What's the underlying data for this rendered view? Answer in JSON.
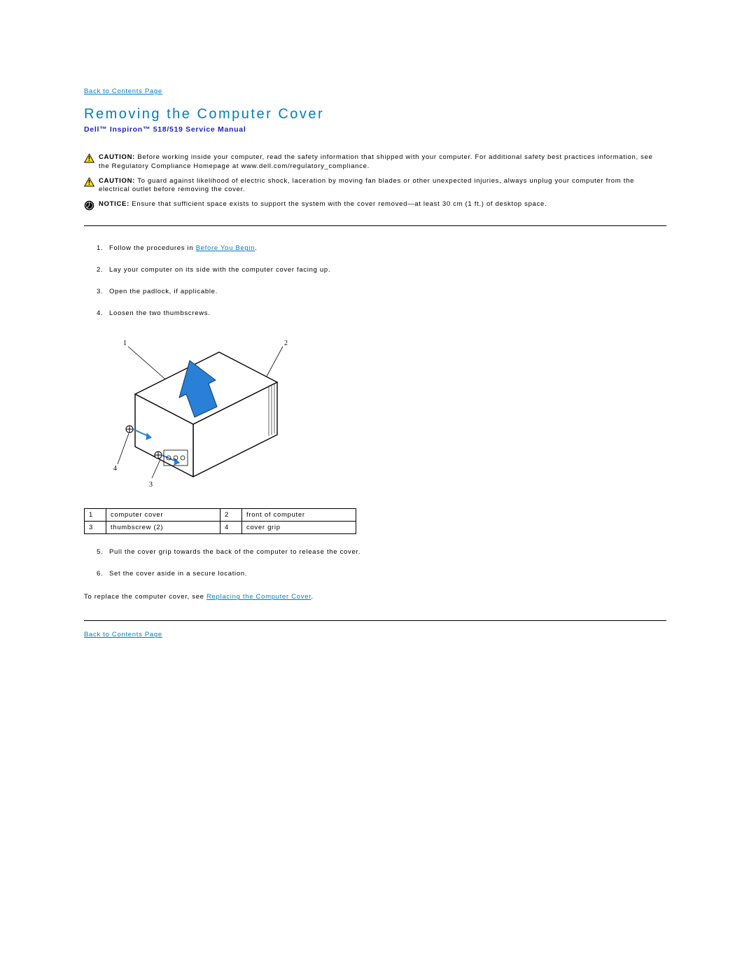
{
  "nav": {
    "back_top": "Back to Contents Page",
    "back_bottom": "Back to Contents Page"
  },
  "heading": {
    "title": "Removing the Computer Cover",
    "subtitle": "Dell™ Inspiron™ 518/519 Service Manual"
  },
  "admon": {
    "caution1": {
      "head": "CAUTION:",
      "body": "Before working inside your computer, read the safety information that shipped with your computer. For additional safety best practices information, see the Regulatory Compliance Homepage at www.dell.com/regulatory_compliance."
    },
    "caution2": {
      "head": "CAUTION:",
      "body": "To guard against likelihood of electric shock, laceration by moving fan blades or other unexpected injuries, always unplug your computer from the electrical outlet before removing the cover."
    },
    "notice1": {
      "head": "NOTICE:",
      "body": "Ensure that sufficient space exists to support the system with the cover removed—at least 30 cm (1 ft.) of desktop space."
    }
  },
  "steps": {
    "s1a": "Follow the procedures in ",
    "s1link": "Before You Begin",
    "s1b": ".",
    "s2": "Lay your computer on its side with the computer cover facing up.",
    "s3": "Open the padlock, if applicable.",
    "s4": "Loosen the two thumbscrews.",
    "s5": "Pull the cover grip towards the back of the computer to release the cover.",
    "s6": "Set the cover aside in a secure location."
  },
  "figure": {
    "labels": {
      "l1": "1",
      "l2": "2",
      "l3": "3",
      "l4": "4"
    }
  },
  "callouts": {
    "r1": {
      "n1": "1",
      "t1": "computer cover",
      "n2": "2",
      "t2": "front of computer"
    },
    "r2": {
      "n1": "3",
      "t1": "thumbscrew (2)",
      "n2": "4",
      "t2": "cover grip"
    }
  },
  "replace": {
    "pre": "To replace the computer cover, see ",
    "link": "Replacing the Computer Cover",
    "post": "."
  }
}
